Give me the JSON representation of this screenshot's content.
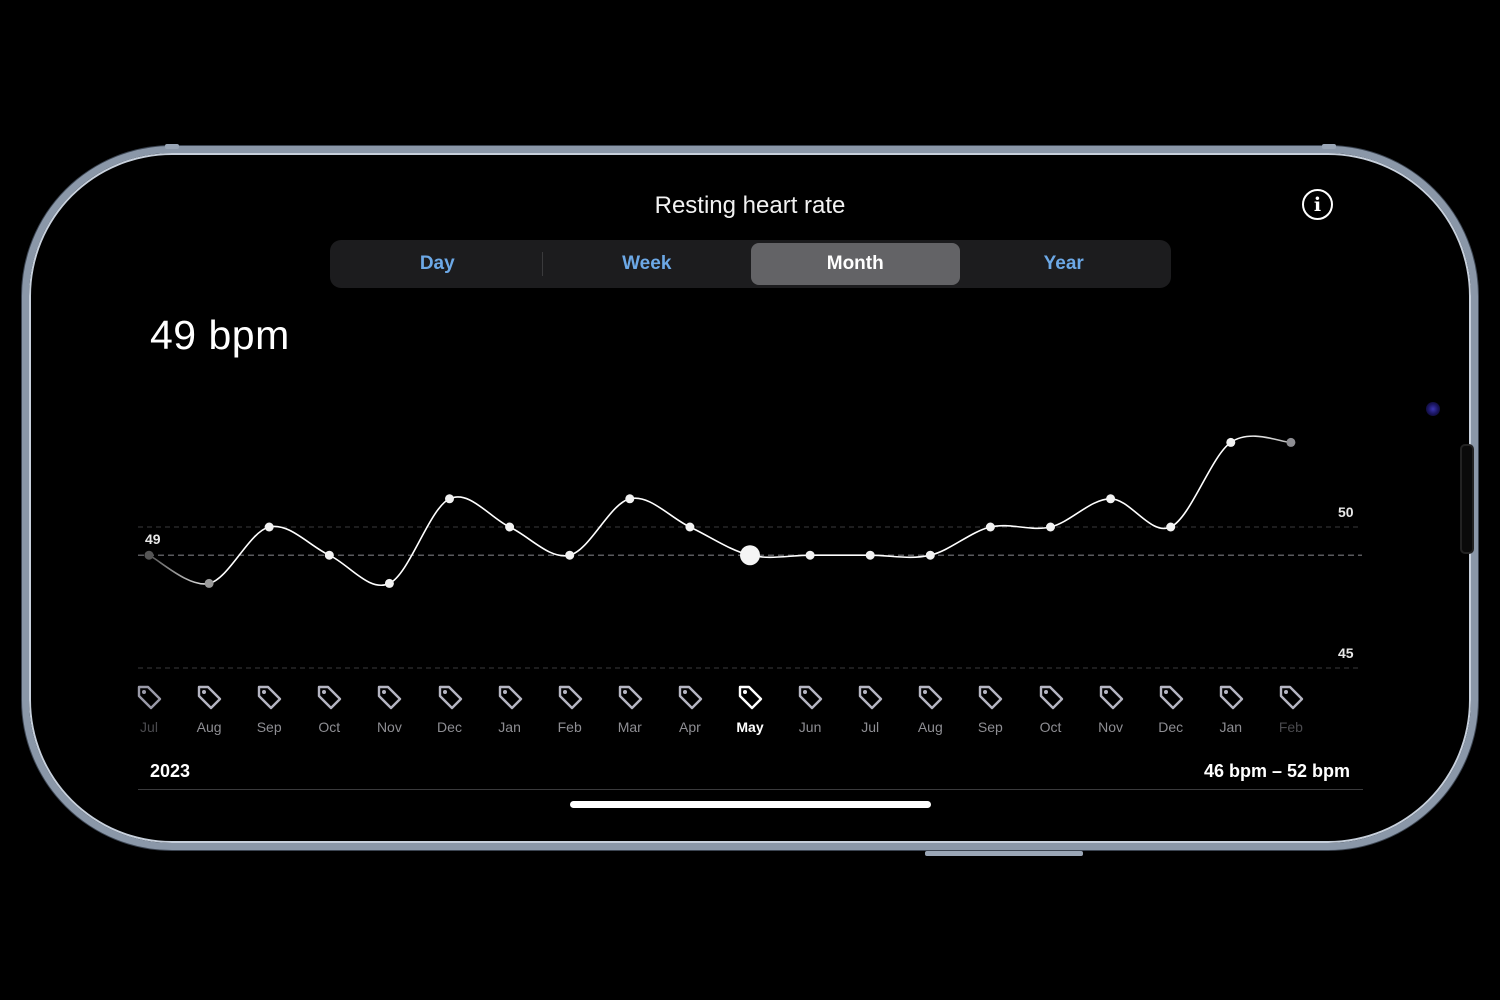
{
  "header": {
    "title": "Resting heart rate",
    "info_icon": "info-circle-icon"
  },
  "segments": [
    {
      "label": "Day",
      "active": false
    },
    {
      "label": "Week",
      "active": false
    },
    {
      "label": "Month",
      "active": true
    },
    {
      "label": "Year",
      "active": false
    }
  ],
  "current_value": "49 bpm",
  "footer": {
    "year": "2023",
    "range": "46 bpm – 52 bpm"
  },
  "colors": {
    "accent": "#6ca8e6",
    "active_segment": "#636366",
    "background": "#000000"
  },
  "chart_data": {
    "type": "line",
    "title": "Resting heart rate",
    "ylabel": "bpm",
    "xlabel": "",
    "y_ticks": [
      {
        "value": 50,
        "label": "50"
      },
      {
        "value": 45,
        "label": "45"
      }
    ],
    "reference_line": {
      "value": 49,
      "label": "49"
    },
    "ylim": [
      45,
      54
    ],
    "grid": true,
    "selected_index": 10,
    "categories": [
      "Jul",
      "Aug",
      "Sep",
      "Oct",
      "Nov",
      "Dec",
      "Jan",
      "Feb",
      "Mar",
      "Apr",
      "May",
      "Jun",
      "Jul",
      "Aug",
      "Sep",
      "Oct",
      "Nov",
      "Dec",
      "Jan",
      "Feb"
    ],
    "values": [
      49,
      48,
      50,
      49,
      48,
      51,
      50,
      49,
      51,
      50,
      49,
      49,
      49,
      49,
      50,
      50,
      51,
      50,
      53,
      53
    ],
    "category_icon": "tag-icon"
  }
}
